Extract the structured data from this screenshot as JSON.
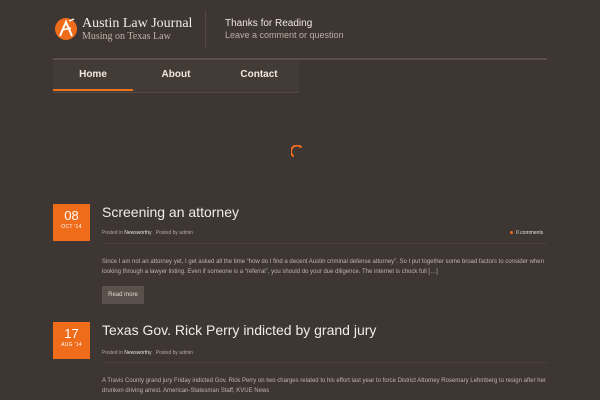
{
  "header": {
    "site_title": "Austin Law Journal",
    "tagline": "Musing on Texas Law",
    "message_title": "Thanks for Reading",
    "message_sub": "Leave a comment or question",
    "accent_color": "#ef6c1a",
    "logo_icon": "pen-nib-icon"
  },
  "nav": {
    "items": [
      {
        "label": "Home",
        "active": true
      },
      {
        "label": "About",
        "active": false
      },
      {
        "label": "Contact",
        "active": false
      }
    ]
  },
  "posts": [
    {
      "day": "08",
      "month": "OCT '14",
      "title": "Screening an attorney",
      "posted_in_label": "Posted in",
      "category": "Newsworthy",
      "posted_by_label": "Posted by",
      "author": "admin",
      "comments": "0 comments",
      "excerpt": "Since I am not an attorney yet, I get asked all the time “how do I find a decent Austin criminal defense attorney”. So I put together some broad factors to consider when looking through a lawyer listing. Even if someone is a “referral”, you should do your due diligence.  The internet is chock full […]",
      "read_more": "Read more"
    },
    {
      "day": "17",
      "month": "AUG '14",
      "title": "Texas Gov. Rick Perry indicted by grand jury",
      "posted_in_label": "Posted in",
      "category": "Newsworthy",
      "posted_by_label": "Posted by",
      "author": "admin",
      "excerpt": "A Travis County grand jury Friday indicted Gov. Rick Perry on two charges related to his effort last year to force District Attorney Rosemary Lehmberg to resign after her drunken driving arrest. American-Statesman Staff, KVUE News"
    }
  ]
}
